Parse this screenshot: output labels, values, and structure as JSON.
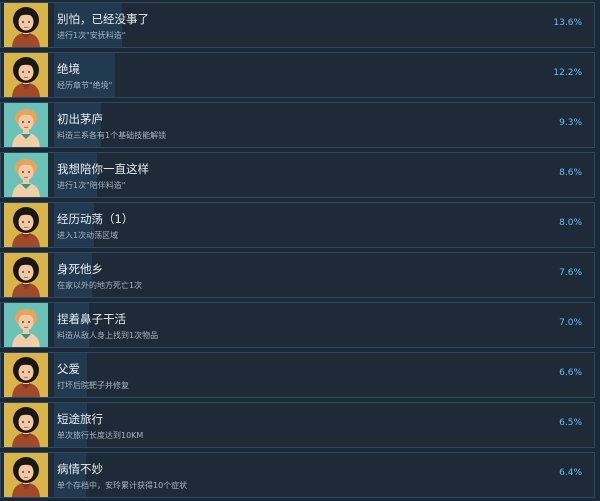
{
  "achievements": [
    {
      "title": "别怕，已经没事了",
      "desc": "进行1次\"安抚料造\"",
      "percent": "13.6%",
      "value": 13.6,
      "avatar": "woman-portrait-icon",
      "bg": "#d9b44a"
    },
    {
      "title": "绝境",
      "desc": "经历章节\"绝境\"",
      "percent": "12.2%",
      "value": 12.2,
      "avatar": "woman-portrait-icon",
      "bg": "#d9b44a"
    },
    {
      "title": "初出茅庐",
      "desc": "料造三系各有1个基础技能解锁",
      "percent": "9.3%",
      "value": 9.3,
      "avatar": "boy-portrait-icon",
      "bg": "#6cc2b7"
    },
    {
      "title": "我想陪你一直这样",
      "desc": "进行1次\"陪伴料造\"",
      "percent": "8.6%",
      "value": 8.6,
      "avatar": "boy-portrait-icon",
      "bg": "#6cc2b7"
    },
    {
      "title": "经历动荡（1）",
      "desc": "进入1次动荡区域",
      "percent": "8.0%",
      "value": 8.0,
      "avatar": "woman-portrait-icon",
      "bg": "#d9b44a"
    },
    {
      "title": "身死他乡",
      "desc": "在家以外的地方死亡1次",
      "percent": "7.6%",
      "value": 7.6,
      "avatar": "woman-portrait-icon",
      "bg": "#d9b44a"
    },
    {
      "title": "捏着鼻子干活",
      "desc": "料造从敌人身上找到1次物品",
      "percent": "7.0%",
      "value": 7.0,
      "avatar": "boy-portrait-icon",
      "bg": "#6cc2b7"
    },
    {
      "title": "父爱",
      "desc": "打坏后院靶子并修复",
      "percent": "6.6%",
      "value": 6.6,
      "avatar": "woman-portrait-icon",
      "bg": "#d9b44a"
    },
    {
      "title": "短途旅行",
      "desc": "单次旅行长度达到10KM",
      "percent": "6.5%",
      "value": 6.5,
      "avatar": "woman-portrait-icon",
      "bg": "#d9b44a"
    },
    {
      "title": "病情不妙",
      "desc": "单个存档中，安玲累计获得10个症状",
      "percent": "6.4%",
      "value": 6.4,
      "avatar": "woman-portrait-icon",
      "bg": "#d9b44a"
    }
  ]
}
